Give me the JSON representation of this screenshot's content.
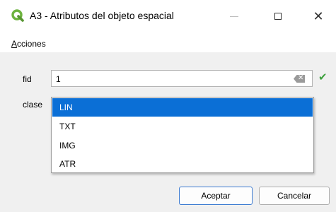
{
  "window": {
    "title": "A3 - Atributos del objeto espacial",
    "controls": {
      "minimize": "—",
      "maximize": "☐",
      "close": "✕"
    }
  },
  "menu": {
    "items": [
      {
        "accel": "A",
        "rest": "cciones"
      }
    ]
  },
  "form": {
    "fid": {
      "label": "fid",
      "value": "1",
      "valid_icon": "check-icon"
    },
    "clase": {
      "label": "clase",
      "options": [
        "LIN",
        "TXT",
        "IMG",
        "ATR"
      ],
      "selected": "LIN"
    }
  },
  "buttons": {
    "ok": "Aceptar",
    "cancel": "Cancelar"
  },
  "colors": {
    "selection": "#0b6fd6",
    "valid": "#3fa13f",
    "qgis_green": "#6db33f"
  }
}
